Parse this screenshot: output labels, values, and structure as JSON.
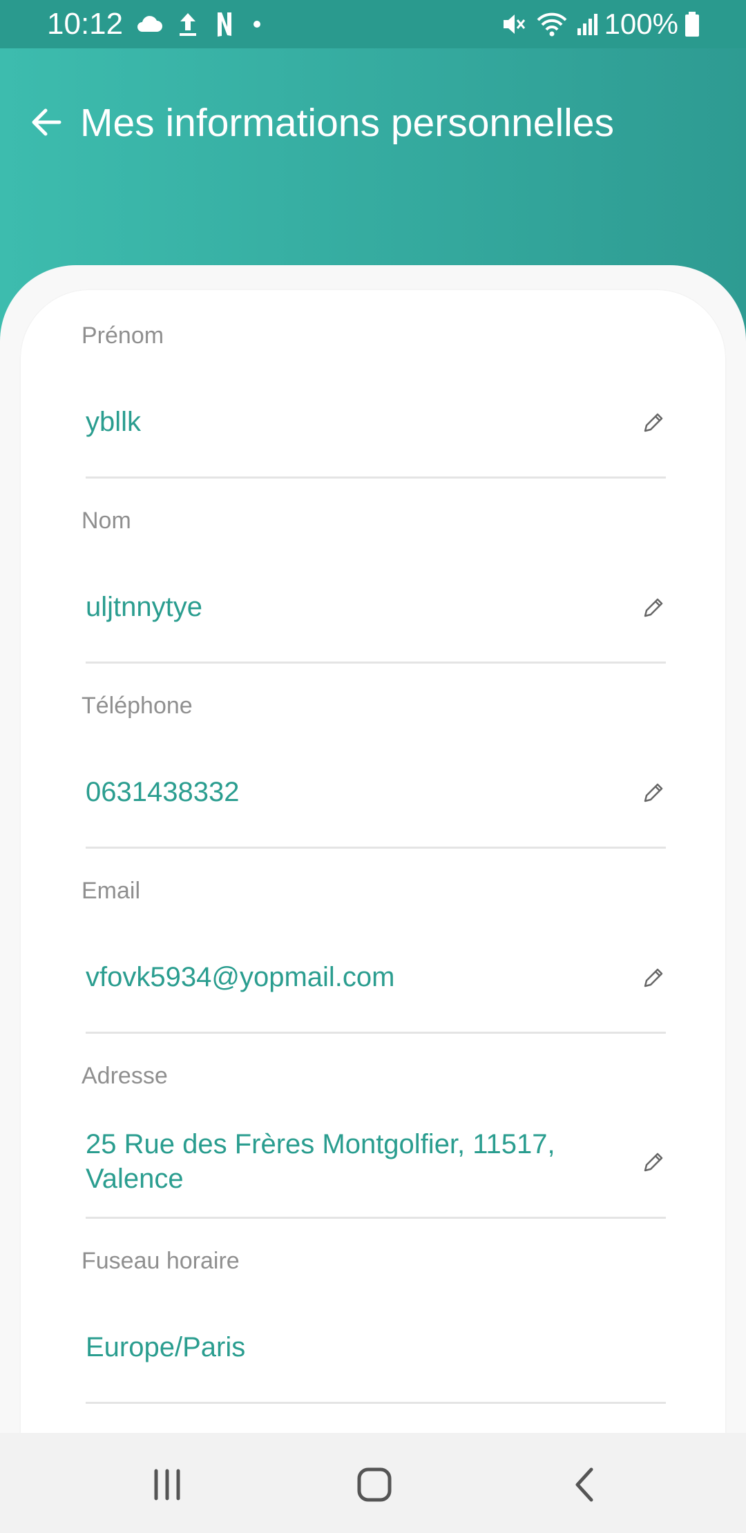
{
  "status_bar": {
    "time": "10:12",
    "battery": "100%",
    "left_icons": [
      "cloud-icon",
      "upload-icon",
      "netflix-icon",
      "dot-icon"
    ],
    "right_icons": [
      "mute-icon",
      "wifi-icon",
      "signal-icon",
      "battery-icon"
    ]
  },
  "header": {
    "title": "Mes informations personnelles",
    "back_icon": "arrow-left-icon"
  },
  "fields": [
    {
      "label": "Prénom",
      "value": "ybllk",
      "editable": true
    },
    {
      "label": "Nom",
      "value": "uljtnnytye",
      "editable": true
    },
    {
      "label": "Téléphone",
      "value": "0631438332",
      "editable": true
    },
    {
      "label": "Email",
      "value": "vfovk5934@yopmail.com",
      "editable": true
    },
    {
      "label": "Adresse",
      "value_line1": "25 Rue des Frères Montgolfier, 11517,",
      "value_line2": "Valence",
      "editable": true
    },
    {
      "label": "Fuseau horaire",
      "value": "Europe/Paris",
      "editable": false
    }
  ],
  "colors": {
    "accent": "#2a9d8f",
    "header_gradient_start": "#3dbcae",
    "header_gradient_end": "#2e9b92",
    "status_bar": "#2a9a8e",
    "label": "#8f8f8f"
  },
  "nav_bar": {
    "icons": [
      "recent-apps-icon",
      "home-icon",
      "back-icon"
    ]
  }
}
